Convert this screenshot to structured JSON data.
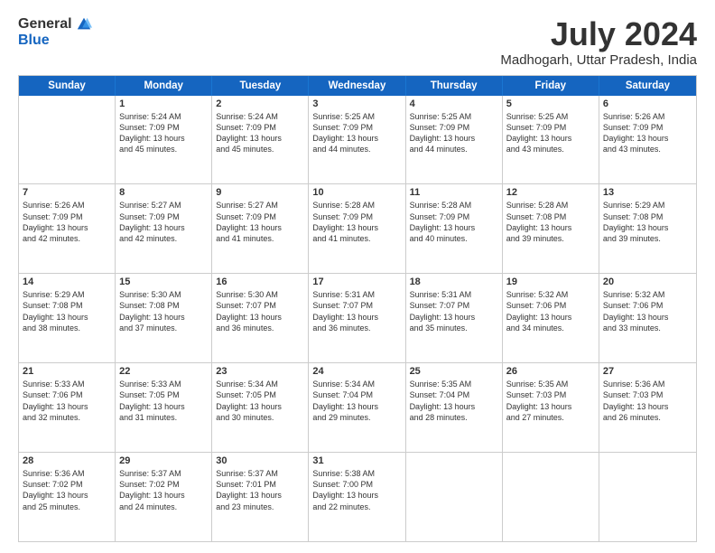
{
  "logo": {
    "general": "General",
    "blue": "Blue"
  },
  "title": "July 2024",
  "subtitle": "Madhogarh, Uttar Pradesh, India",
  "header_days": [
    "Sunday",
    "Monday",
    "Tuesday",
    "Wednesday",
    "Thursday",
    "Friday",
    "Saturday"
  ],
  "weeks": [
    [
      {
        "day": "",
        "info": ""
      },
      {
        "day": "1",
        "info": "Sunrise: 5:24 AM\nSunset: 7:09 PM\nDaylight: 13 hours\nand 45 minutes."
      },
      {
        "day": "2",
        "info": "Sunrise: 5:24 AM\nSunset: 7:09 PM\nDaylight: 13 hours\nand 45 minutes."
      },
      {
        "day": "3",
        "info": "Sunrise: 5:25 AM\nSunset: 7:09 PM\nDaylight: 13 hours\nand 44 minutes."
      },
      {
        "day": "4",
        "info": "Sunrise: 5:25 AM\nSunset: 7:09 PM\nDaylight: 13 hours\nand 44 minutes."
      },
      {
        "day": "5",
        "info": "Sunrise: 5:25 AM\nSunset: 7:09 PM\nDaylight: 13 hours\nand 43 minutes."
      },
      {
        "day": "6",
        "info": "Sunrise: 5:26 AM\nSunset: 7:09 PM\nDaylight: 13 hours\nand 43 minutes."
      }
    ],
    [
      {
        "day": "7",
        "info": "Sunrise: 5:26 AM\nSunset: 7:09 PM\nDaylight: 13 hours\nand 42 minutes."
      },
      {
        "day": "8",
        "info": "Sunrise: 5:27 AM\nSunset: 7:09 PM\nDaylight: 13 hours\nand 42 minutes."
      },
      {
        "day": "9",
        "info": "Sunrise: 5:27 AM\nSunset: 7:09 PM\nDaylight: 13 hours\nand 41 minutes."
      },
      {
        "day": "10",
        "info": "Sunrise: 5:28 AM\nSunset: 7:09 PM\nDaylight: 13 hours\nand 41 minutes."
      },
      {
        "day": "11",
        "info": "Sunrise: 5:28 AM\nSunset: 7:09 PM\nDaylight: 13 hours\nand 40 minutes."
      },
      {
        "day": "12",
        "info": "Sunrise: 5:28 AM\nSunset: 7:08 PM\nDaylight: 13 hours\nand 39 minutes."
      },
      {
        "day": "13",
        "info": "Sunrise: 5:29 AM\nSunset: 7:08 PM\nDaylight: 13 hours\nand 39 minutes."
      }
    ],
    [
      {
        "day": "14",
        "info": "Sunrise: 5:29 AM\nSunset: 7:08 PM\nDaylight: 13 hours\nand 38 minutes."
      },
      {
        "day": "15",
        "info": "Sunrise: 5:30 AM\nSunset: 7:08 PM\nDaylight: 13 hours\nand 37 minutes."
      },
      {
        "day": "16",
        "info": "Sunrise: 5:30 AM\nSunset: 7:07 PM\nDaylight: 13 hours\nand 36 minutes."
      },
      {
        "day": "17",
        "info": "Sunrise: 5:31 AM\nSunset: 7:07 PM\nDaylight: 13 hours\nand 36 minutes."
      },
      {
        "day": "18",
        "info": "Sunrise: 5:31 AM\nSunset: 7:07 PM\nDaylight: 13 hours\nand 35 minutes."
      },
      {
        "day": "19",
        "info": "Sunrise: 5:32 AM\nSunset: 7:06 PM\nDaylight: 13 hours\nand 34 minutes."
      },
      {
        "day": "20",
        "info": "Sunrise: 5:32 AM\nSunset: 7:06 PM\nDaylight: 13 hours\nand 33 minutes."
      }
    ],
    [
      {
        "day": "21",
        "info": "Sunrise: 5:33 AM\nSunset: 7:06 PM\nDaylight: 13 hours\nand 32 minutes."
      },
      {
        "day": "22",
        "info": "Sunrise: 5:33 AM\nSunset: 7:05 PM\nDaylight: 13 hours\nand 31 minutes."
      },
      {
        "day": "23",
        "info": "Sunrise: 5:34 AM\nSunset: 7:05 PM\nDaylight: 13 hours\nand 30 minutes."
      },
      {
        "day": "24",
        "info": "Sunrise: 5:34 AM\nSunset: 7:04 PM\nDaylight: 13 hours\nand 29 minutes."
      },
      {
        "day": "25",
        "info": "Sunrise: 5:35 AM\nSunset: 7:04 PM\nDaylight: 13 hours\nand 28 minutes."
      },
      {
        "day": "26",
        "info": "Sunrise: 5:35 AM\nSunset: 7:03 PM\nDaylight: 13 hours\nand 27 minutes."
      },
      {
        "day": "27",
        "info": "Sunrise: 5:36 AM\nSunset: 7:03 PM\nDaylight: 13 hours\nand 26 minutes."
      }
    ],
    [
      {
        "day": "28",
        "info": "Sunrise: 5:36 AM\nSunset: 7:02 PM\nDaylight: 13 hours\nand 25 minutes."
      },
      {
        "day": "29",
        "info": "Sunrise: 5:37 AM\nSunset: 7:02 PM\nDaylight: 13 hours\nand 24 minutes."
      },
      {
        "day": "30",
        "info": "Sunrise: 5:37 AM\nSunset: 7:01 PM\nDaylight: 13 hours\nand 23 minutes."
      },
      {
        "day": "31",
        "info": "Sunrise: 5:38 AM\nSunset: 7:00 PM\nDaylight: 13 hours\nand 22 minutes."
      },
      {
        "day": "",
        "info": ""
      },
      {
        "day": "",
        "info": ""
      },
      {
        "day": "",
        "info": ""
      }
    ]
  ]
}
